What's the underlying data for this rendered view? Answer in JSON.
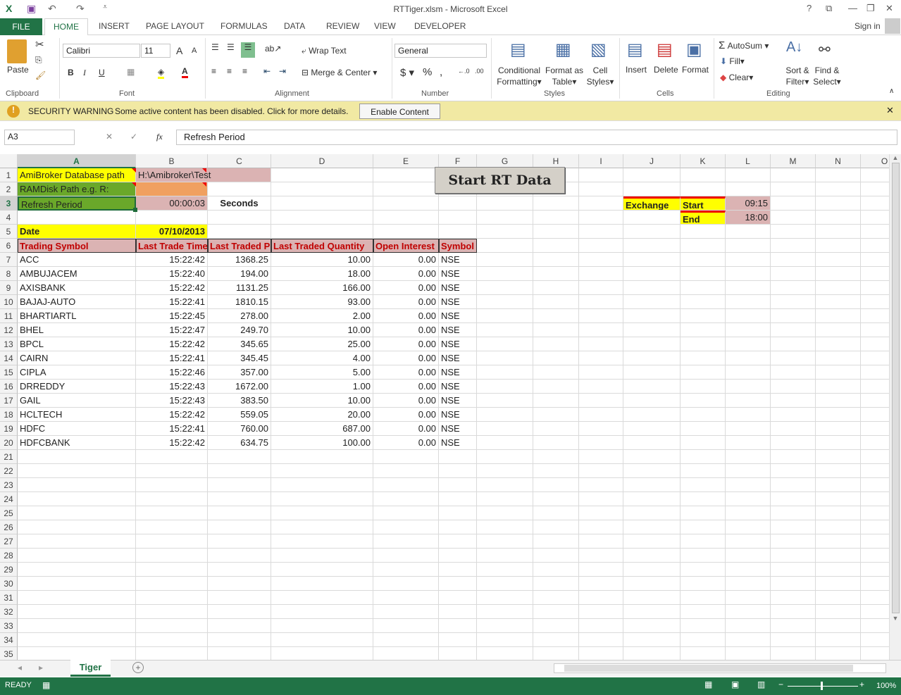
{
  "window": {
    "title": "RTTiger.xlsm - Microsoft Excel",
    "sign_in": "Sign in"
  },
  "tabs": [
    "FILE",
    "HOME",
    "INSERT",
    "PAGE LAYOUT",
    "FORMULAS",
    "DATA",
    "REVIEW",
    "VIEW",
    "DEVELOPER"
  ],
  "ribbon": {
    "paste": "Paste",
    "font_name": "Calibri",
    "font_size": "11",
    "wrap_text": "Wrap Text",
    "merge_center": "Merge & Center",
    "number_format": "General",
    "conditional": "Conditional",
    "formatting": "Formatting",
    "format_as": "Format as",
    "table": "Table",
    "cell": "Cell",
    "styles_btn": "Styles",
    "insert": "Insert",
    "delete": "Delete",
    "format": "Format",
    "autosum": "AutoSum",
    "fill": "Fill",
    "clear": "Clear",
    "sort": "Sort &",
    "filter": "Filter",
    "find": "Find &",
    "select": "Select",
    "groups": {
      "clipboard": "Clipboard",
      "font": "Font",
      "alignment": "Alignment",
      "number": "Number",
      "styles": "Styles",
      "cells": "Cells",
      "editing": "Editing"
    }
  },
  "warning": {
    "title": "SECURITY WARNING",
    "message": "Some active content has been disabled. Click for more details.",
    "button": "Enable Content"
  },
  "formula_bar": {
    "name_box": "A3",
    "content": "Refresh Period",
    "fx": "fx"
  },
  "columns": [
    "A",
    "B",
    "C",
    "D",
    "E",
    "F",
    "G",
    "H",
    "I",
    "J",
    "K",
    "L",
    "M",
    "N",
    "O"
  ],
  "cells": {
    "A1": "AmiBroker Database path",
    "B1": "H:\\Amibroker\\Test",
    "A2": "RAMDisk Path e.g. R:",
    "A3": "Refresh Period",
    "B3": "00:00:03",
    "C3": "Seconds",
    "A5": "Date",
    "B5": "07/10/2013",
    "J3": "Exchange",
    "K3": "Start",
    "L3": "09:15",
    "K4": "End",
    "L4": "18:00"
  },
  "table": {
    "headers": [
      "Trading Symbol",
      "Last Trade Time",
      "Last Traded Price",
      "Last Traded Quantity",
      "Open Interest",
      "Symbol"
    ],
    "rows": [
      [
        "ACC",
        "15:22:42",
        "1368.25",
        "10.00",
        "0.00",
        "NSE"
      ],
      [
        "AMBUJACEM",
        "15:22:40",
        "194.00",
        "18.00",
        "0.00",
        "NSE"
      ],
      [
        "AXISBANK",
        "15:22:42",
        "1131.25",
        "166.00",
        "0.00",
        "NSE"
      ],
      [
        "BAJAJ-AUTO",
        "15:22:41",
        "1810.15",
        "93.00",
        "0.00",
        "NSE"
      ],
      [
        "BHARTIARTL",
        "15:22:45",
        "278.00",
        "2.00",
        "0.00",
        "NSE"
      ],
      [
        "BHEL",
        "15:22:47",
        "249.70",
        "10.00",
        "0.00",
        "NSE"
      ],
      [
        "BPCL",
        "15:22:42",
        "345.65",
        "25.00",
        "0.00",
        "NSE"
      ],
      [
        "CAIRN",
        "15:22:41",
        "345.45",
        "4.00",
        "0.00",
        "NSE"
      ],
      [
        "CIPLA",
        "15:22:46",
        "357.00",
        "5.00",
        "0.00",
        "NSE"
      ],
      [
        "DRREDDY",
        "15:22:43",
        "1672.00",
        "1.00",
        "0.00",
        "NSE"
      ],
      [
        "GAIL",
        "15:22:43",
        "383.50",
        "10.00",
        "0.00",
        "NSE"
      ],
      [
        "HCLTECH",
        "15:22:42",
        "559.05",
        "20.00",
        "0.00",
        "NSE"
      ],
      [
        "HDFC",
        "15:22:41",
        "760.00",
        "687.00",
        "0.00",
        "NSE"
      ],
      [
        "HDFCBANK",
        "15:22:42",
        "634.75",
        "100.00",
        "0.00",
        "NSE"
      ]
    ]
  },
  "macro_button": "Start RT Data",
  "sheet_tabs": [
    "Tiger"
  ],
  "status": {
    "mode": "READY",
    "zoom": "100%"
  },
  "colors": {
    "excel_green": "#217346",
    "yellow": "#ffff00",
    "green_cell": "#6aa82a",
    "pink_cell": "#dbb3b3",
    "orange_cell": "#f0a060",
    "header_red": "#c00000"
  }
}
